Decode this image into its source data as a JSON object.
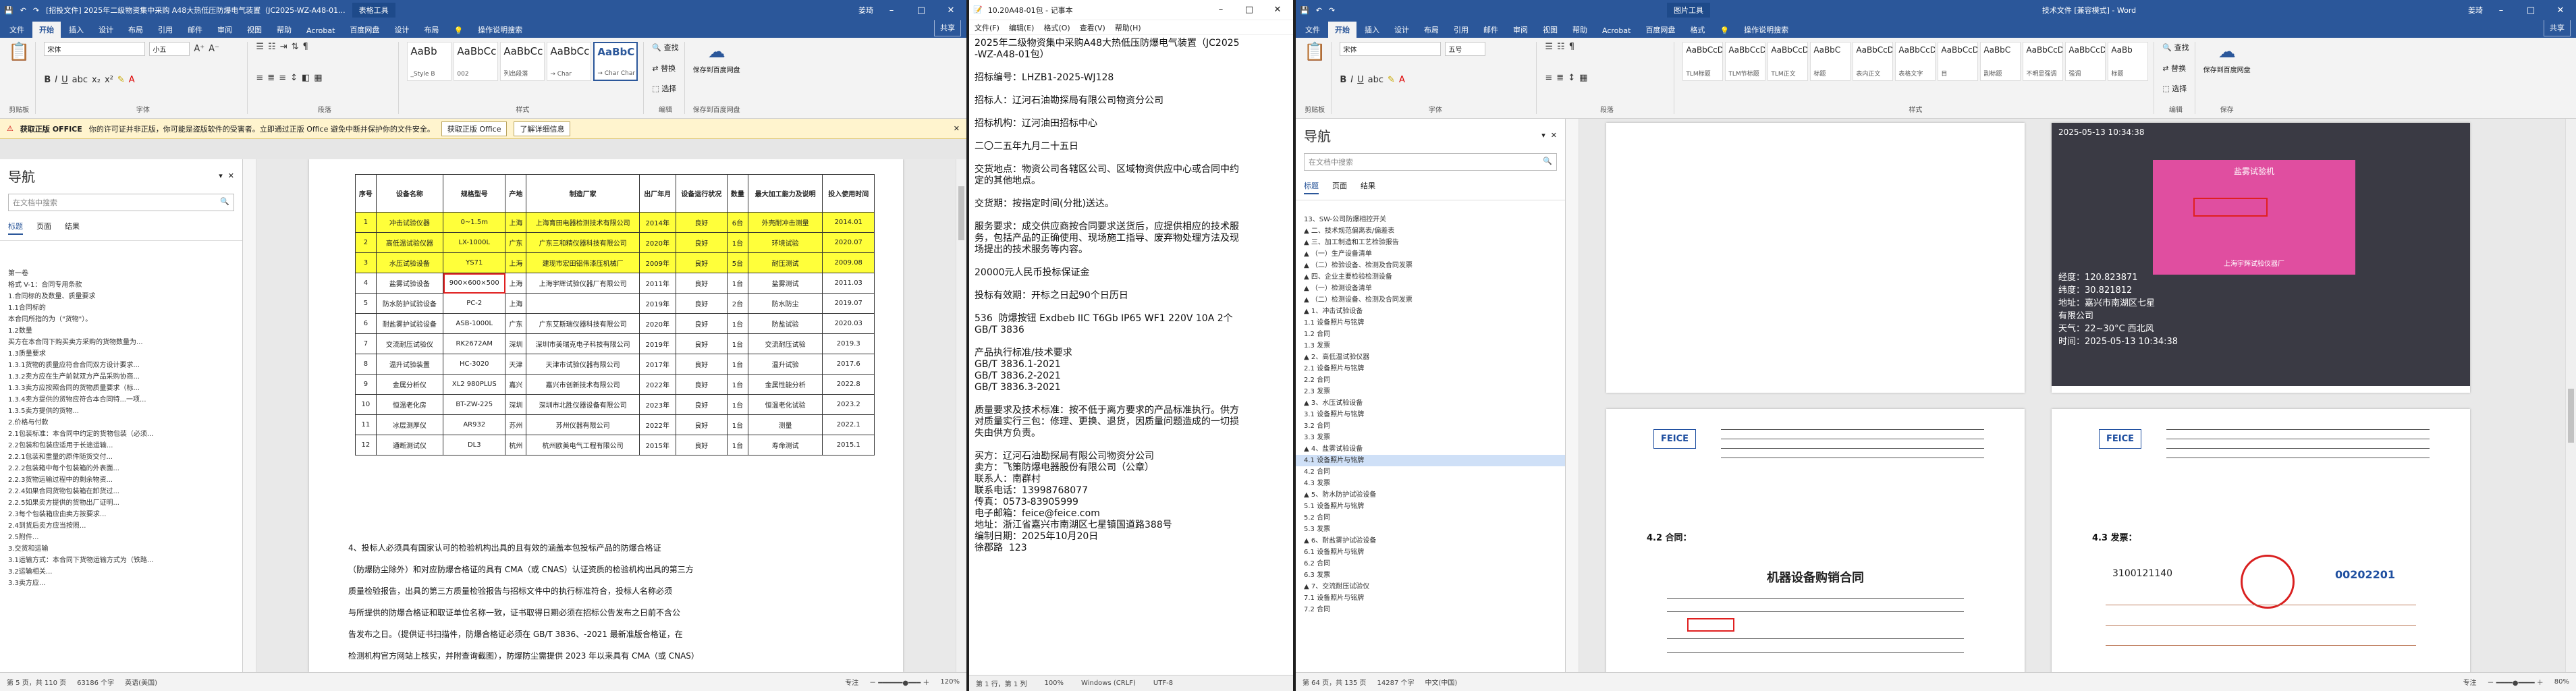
{
  "w1": {
    "title": "[招投文件] 2025年二级物资集中采购 A48大热低压防爆电气装置（JC2025-WZ-A48-01...",
    "context_tab": "表格工具",
    "user": "姜琦",
    "tabs": [
      "文件",
      "开始",
      "插入",
      "设计",
      "布局",
      "引用",
      "邮件",
      "审阅",
      "视图",
      "帮助",
      "Acrobat",
      "百度网盘",
      "设计",
      "布局"
    ],
    "search_hint": "操作说明搜索",
    "share": "共享",
    "font_name": "宋体",
    "font_size": "小五",
    "groups": [
      "剪贴板",
      "字体",
      "段落",
      "样式",
      "编辑",
      "保存",
      "保存到百度网盘"
    ],
    "styles": [
      {
        "preview": "AaBb",
        "name": "_Style B"
      },
      {
        "preview": "AaBbCc",
        "name": "002"
      },
      {
        "preview": "AaBbCc",
        "name": "列出段落"
      },
      {
        "preview": "AaBbCc",
        "name": "→ Char"
      },
      {
        "preview": "AaBbC",
        "name": "→ Char Char"
      }
    ],
    "edit_labels": [
      "查找",
      "替换",
      "选择"
    ],
    "save_labels": [
      "保存到百度网盘"
    ],
    "notice": {
      "bold": "获取正版 OFFICE",
      "text": "你的许可证并非正版，你可能是盗版软件的受害者。立即通过正版 Office 避免中断并保护你的文件安全。",
      "btn1": "获取正版 Office",
      "btn2": "了解详细信息"
    },
    "nav": {
      "title": "导航",
      "search": "在文档中搜索",
      "tabs": [
        "标题",
        "页面",
        "结果"
      ],
      "items": [
        "第一卷",
        "",
        "格式 V-1：合同专用条款",
        "1.合同标的及数量、质量要求",
        "  1.1合同标的",
        "    本合同所指的为（\"货物\"）。",
        "  1.2数量",
        "    买方在本合同下购买卖方采购的货物数量为...",
        "  1.3质量要求",
        "    1.3.1货物的质量应符合合同双方设计要求...",
        "    1.3.2卖方应在生产前就双方产品采购协商...",
        "    1.3.3卖方应按照合同的货物质量要求（标...",
        "    1.3.4卖方提供的货物应符合本合同特...一项...",
        "    1.3.5卖方提供的货物...",
        "2.价格与付款",
        "  2.1包装标准：本合同中约定的货物包装（必须...",
        "  2.2包装和包装应适用于长途运输...",
        "    2.2.1包装和重量的原件随货交付...",
        "    2.2.2包装箱中每个包装箱的外表面...",
        "    2.2.3货物运输过程中的剩余物资...",
        "    2.2.4如果合同货物包装箱在卸货过...",
        "    2.2.5如果卖方提供的货物出厂证明...",
        "  2.3每个包装箱应由卖方按要求...",
        "  2.4到货后卖方应当按照...",
        "  2.5附件...",
        "3.交货和运输",
        "  3.1运输方式：本合同下货物运输方式为（铁路...",
        "  3.2运输相关...",
        "  3.3卖方应..."
      ],
      "highlight_index": 1
    },
    "table": {
      "headers": [
        "序号",
        "设备名称",
        "规格型号",
        "产地",
        "制造厂家",
        "出厂年月",
        "设备运行状况",
        "数量",
        "最大加工能力及说明",
        "投入使用时间"
      ],
      "rows": [
        {
          "y": true,
          "cells": [
            "1",
            "冲击试验仪器",
            "0~1.5m",
            "上海",
            "上海育田电器检测技术有限公司",
            "2014年",
            "良好",
            "6台",
            "外壳耐冲击测量",
            "2014.01"
          ]
        },
        {
          "y": true,
          "cells": [
            "2",
            "高低温试验仪器",
            "LX-1000L",
            "广东",
            "广东三和精仪器科技有限公司",
            "2020年",
            "良好",
            "1台",
            "环境试验",
            "2020.07"
          ]
        },
        {
          "y": true,
          "cells": [
            "3",
            "水压试验设备",
            "YS71",
            "上海",
            "建现市宏田铝伟漆压机械厂",
            "2009年",
            "良好",
            "5台",
            "耐压测试",
            "2009.08"
          ]
        },
        {
          "y": false,
          "cells": [
            "4",
            "盐雾试验设备",
            "900×600×500",
            "上海",
            "上海宇辉试验仪器厂有限公司",
            "2011年",
            "良好",
            "1台",
            "盐雾测试",
            "2011.03"
          ]
        },
        {
          "y": false,
          "cells": [
            "5",
            "防水防护试验设备",
            "PC-2",
            "上海",
            "",
            "2019年",
            "良好",
            "2台",
            "防水防尘",
            "2019.07"
          ]
        },
        {
          "y": false,
          "cells": [
            "6",
            "耐盐雾护试验设备",
            "ASB-1000L",
            "广东",
            "广东艾斯瑞仪器科技有限公司",
            "2020年",
            "良好",
            "1台",
            "防盐试验",
            "2020.03"
          ]
        },
        {
          "y": false,
          "cells": [
            "7",
            "交流耐压试验仪",
            "RK2672AM",
            "深圳",
            "深圳市美瑞克电子科技有限公司",
            "2019年",
            "良好",
            "1台",
            "交流耐压试验",
            "2019.3"
          ]
        },
        {
          "y": false,
          "cells": [
            "8",
            "温升试验装置",
            "HC-3020",
            "天津",
            "天津市试验仪器有限公司",
            "2017年",
            "良好",
            "1台",
            "温升试验",
            "2017.6"
          ]
        },
        {
          "y": false,
          "cells": [
            "9",
            "金属分析仪",
            "XL2 980PLUS",
            "嘉兴",
            "嘉兴市创新技术有限公司",
            "2022年",
            "良好",
            "1台",
            "金属性能分析",
            "2022.8"
          ]
        },
        {
          "y": false,
          "cells": [
            "10",
            "恒温老化房",
            "BT-ZW-225",
            "深圳",
            "深圳市北胜仪器设备有限公司",
            "2023年",
            "良好",
            "1台",
            "恒温老化试验",
            "2023.2"
          ]
        },
        {
          "y": false,
          "cells": [
            "11",
            "冰层测厚仪",
            "AR932",
            "苏州",
            "苏州仪器有限公司",
            "2022年",
            "良好",
            "1台",
            "测量",
            "2022.1"
          ]
        },
        {
          "y": false,
          "cells": [
            "12",
            "通断测试仪",
            "DL3",
            "杭州",
            "杭州欧美电气工程有限公司",
            "2015年",
            "良好",
            "1台",
            "寿命测试",
            "2015.1"
          ]
        }
      ]
    },
    "paragraph": [
      "4、投标人必须具有国家认可的检验机构出具的且有效的涵盖本包投标产品的防爆合格证",
      "（防爆防尘除外）和对应防爆合格证的具有 CMA（或 CNAS）认证资质的检验机构出具的第三方",
      "质量检验报告，出具的第三方质量检验报告与招标文件中的执行标准符合，投标人名称必须",
      "与所提供的防爆合格证和取证单位名称一致，证书取得日期必须在招标公告发布之日前不含公",
      "告发布之日。（提供证书扫描件，防爆合格证必须在 GB/T 3836、-2021 最新准版合格证，在",
      "检测机构官方网站上核实，并附查询截图），防爆防尘需提供 2023 年以来具有 CMA（或 CNAS）"
    ],
    "status": {
      "page": "第 5 页，共 110 页",
      "words": "63186 个字",
      "lang": "英语(美国)",
      "focus": "专注",
      "zoom": "120%"
    }
  },
  "w2": {
    "title": "10.20A48-01包 - 记事本",
    "menu": [
      "文件(F)",
      "编辑(E)",
      "格式(O)",
      "查看(V)",
      "帮助(H)"
    ],
    "lines": [
      "2025年二级物资集中采购A48大热低压防爆电气装置（JC2025",
      "-WZ-A48-01包）",
      "",
      "招标编号：LHZB1-2025-WJ128",
      "",
      "招标人：辽河石油勘探局有限公司物资分公司",
      "",
      "招标机构：辽河油田招标中心",
      "",
      "二〇二五年九月二十五日",
      "",
      "交货地点：物资公司各辖区公司、区域物资供应中心或合同中约",
      "定的其他地点。",
      "",
      "交货期：按指定时间(分批)送达。",
      "",
      "服务要求：成交供应商按合同要求送货后，应提供相应的技术服",
      "务，包括产品的正确使用、现场施工指导、废弃物处理方法及现",
      "场提出的技术服务等内容。",
      "",
      "20000元人民币投标保证金",
      "",
      "投标有效期：开标之日起90个日历日",
      "",
      "536  防爆按钮 Exdbeb IIC T6Gb IP65 WF1 220V 10A 2个",
      "GB/T 3836",
      "",
      "产品执行标准/技术要求",
      "GB/T 3836.1-2021",
      "GB/T 3836.2-2021",
      "GB/T 3836.3-2021",
      "",
      "质量要求及技术标准：按不低于离方要求的产品标准执行。供方",
      "对质量实行三包：修理、更换、退货，因质量问题造成的一切损",
      "失由供方负责。",
      "",
      "买方：辽河石油勘探局有限公司物资分公司",
      "卖方：飞策防爆电器股份有限公司（公章）",
      "联系人：南群村",
      "联系电话：13998768077",
      "传真：0573-83905999",
      "电子邮箱：feice@feice.com",
      "地址：浙江省嘉兴市南湖区七星镇国道路388号",
      "编制日期：2025年10月20日",
      "徐郡路  123"
    ],
    "status": {
      "pos": "第 1 行，第 1 列",
      "zoom": "100%",
      "eol": "Windows (CRLF)",
      "enc": "UTF-8"
    }
  },
  "w3": {
    "title": "技术文件 [兼容模式] - Word",
    "context_tab": "图片工具",
    "user": "姜琦",
    "tabs": [
      "文件",
      "开始",
      "插入",
      "设计",
      "布局",
      "引用",
      "邮件",
      "审阅",
      "视图",
      "帮助",
      "Acrobat",
      "百度网盘",
      "格式"
    ],
    "search_hint": "操作说明搜索",
    "share": "共享",
    "font_name": "宋体",
    "font_size": "五号",
    "groups": [
      "剪贴板",
      "字体",
      "段落",
      "样式",
      "编辑",
      "保存",
      "保存到百度网盘"
    ],
    "styles": [
      {
        "preview": "AaBbCcDd",
        "name": "TLM标题"
      },
      {
        "preview": "AaBbCcDd",
        "name": "TLM节标题"
      },
      {
        "preview": "AaBbCcDd",
        "name": "TLM正文"
      },
      {
        "preview": "AaBbC",
        "name": "标题"
      },
      {
        "preview": "AaBbCcDd",
        "name": "表内正文"
      },
      {
        "preview": "AaBbCcDd",
        "name": "表格文字"
      },
      {
        "preview": "AaBbCcDd",
        "name": "目"
      },
      {
        "preview": "AaBbC",
        "name": "副标题"
      },
      {
        "preview": "AaBbCcDd",
        "name": "不明显强调"
      },
      {
        "preview": "AaBbCcD",
        "name": "强调"
      },
      {
        "preview": "AaBb",
        "name": "标题"
      }
    ],
    "edit_labels": [
      "查找",
      "替换",
      "选择"
    ],
    "nav": {
      "title": "导航",
      "search": "在文档中搜索",
      "tabs": [
        "标题",
        "页面",
        "结果"
      ],
      "items": [
        "  13、SW-公司防爆相控开关",
        "▲ 二、技术规范偏离表/偏差表",
        "▲ 三、加工制造和工艺检验报告",
        "  ▲ （一）生产设备清单",
        "  ▲ （二）检验设备、检测及合同发票",
        "▲ 四、企业主要检验检测设备",
        "  ▲ （一）检测设备清单",
        "  ▲ （二）检测设备、检测及合同发票",
        "    ▲ 1、冲击试验设备",
        "      1.1 设备照片与铭牌",
        "      1.2 合同",
        "      1.3 发票",
        "    ▲ 2、高低温试验仪器",
        "      2.1 设备照片与铭牌",
        "      2.2 合同",
        "      2.3 发票",
        "    ▲ 3、水压试验设备",
        "      3.1 设备照片与铭牌",
        "      3.2 合同",
        "      3.3 发票",
        "    ▲ 4、盐雾试验设备",
        "      4.1 设备照片与铭牌",
        "      4.2 合同",
        "      4.3 发票",
        "    ▲ 5、防水防护试验设备",
        "      5.1 设备照片与铭牌",
        "      5.2 合同",
        "      5.3 发票",
        "    ▲ 6、耐盐雾护试验设备",
        "      6.1 设备照片与铭牌",
        "      6.2 合同",
        "      6.3 发票",
        "    ▲ 7、交流耐压试验仪",
        "      7.1 设备照片与铭牌",
        "      7.2 合同"
      ],
      "highlight_index": 21
    },
    "photo": {
      "timestamp_top": "2025-05-13 10:34:38",
      "overlay": [
        "经度：120.823871",
        "纬度：30.821812",
        "地址：嘉兴市南湖区七星",
        "有限公司",
        "天气：22~30°C 西北风",
        "时间：2025-05-13 10:34:38"
      ],
      "plate_title": "盐雾试验机",
      "plate_maker": "上海宇辉试验仪器厂"
    },
    "captions": {
      "contract": "4.2 合同：",
      "invoice": "4.3 发票："
    },
    "contract_title": "机器设备购销合同",
    "company": "FEICE",
    "invoice_no": "3100121140",
    "invoice_no2": "00202201",
    "status": {
      "page": "第 64 页，共 135 页",
      "words": "14287 个字",
      "lang": "中文(中国)",
      "focus": "专注",
      "zoom": "80%"
    }
  }
}
